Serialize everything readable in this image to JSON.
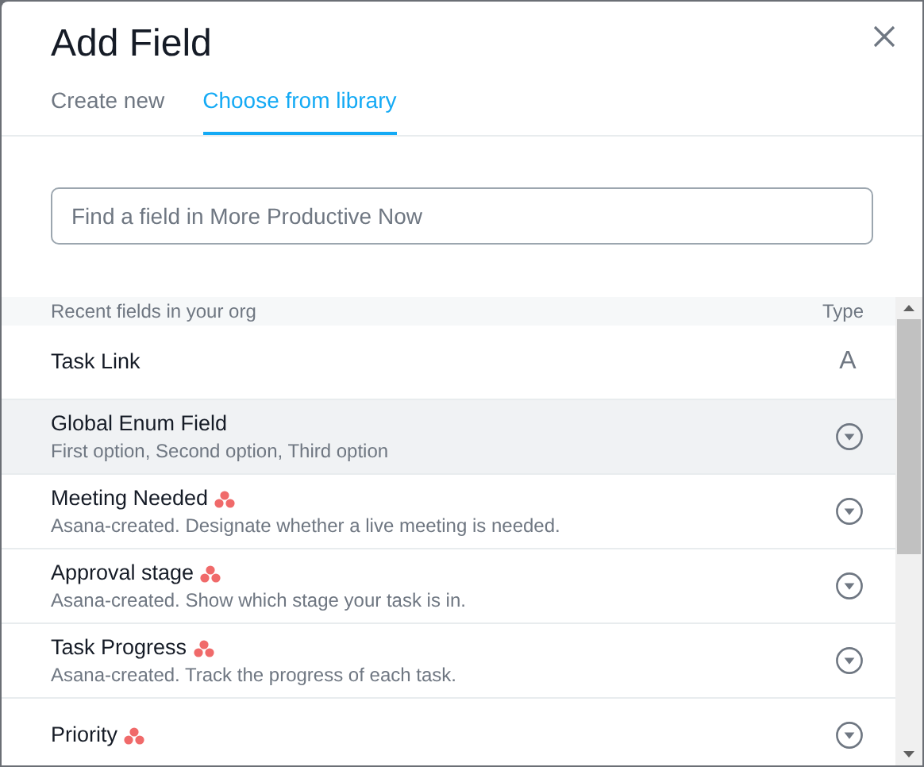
{
  "dialog": {
    "title": "Add Field"
  },
  "tabs": [
    {
      "label": "Create new",
      "selected": false
    },
    {
      "label": "Choose from library",
      "selected": true
    }
  ],
  "search": {
    "placeholder": "Find a field in More Productive Now"
  },
  "list": {
    "header": "Recent fields in your org",
    "type_header": "Type",
    "rows": [
      {
        "name": "Task Link",
        "kind": "text",
        "type_label": "A",
        "asana": false,
        "highlighted": false
      },
      {
        "name": "Global Enum Field",
        "description": "First option, Second option, Third option",
        "kind": "enum",
        "asana": false,
        "highlighted": true
      },
      {
        "name": "Meeting Needed",
        "description": "Asana-created. Designate whether a live meeting is needed.",
        "kind": "enum",
        "asana": true,
        "highlighted": false
      },
      {
        "name": "Approval stage",
        "description": "Asana-created. Show which stage your task is in.",
        "kind": "enum",
        "asana": true,
        "highlighted": false
      },
      {
        "name": "Task Progress",
        "description": "Asana-created. Track the progress of each task.",
        "kind": "enum",
        "asana": true,
        "highlighted": false
      },
      {
        "name": "Priority",
        "kind": "enum",
        "asana": true,
        "highlighted": false
      }
    ]
  }
}
